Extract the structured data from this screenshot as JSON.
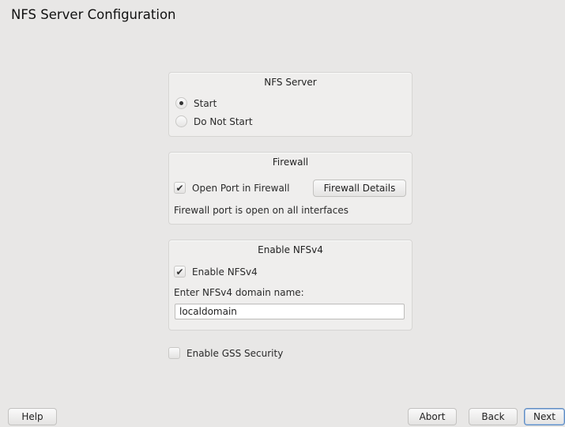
{
  "window": {
    "title": "NFS Server Configuration"
  },
  "nfs_server": {
    "title": "NFS Server",
    "options": [
      {
        "label": "Start",
        "selected": true
      },
      {
        "label": "Do Not Start",
        "selected": false
      }
    ]
  },
  "firewall": {
    "title": "Firewall",
    "open_port_label": "Open Port in Firewall",
    "open_port_checked": true,
    "details_button": "Firewall Details",
    "status_text": "Firewall port is open on all interfaces"
  },
  "nfsv4": {
    "title": "Enable NFSv4",
    "enable_label": "Enable NFSv4",
    "enable_checked": true,
    "domain_label": "Enter NFSv4 domain name:",
    "domain_value": "localdomain"
  },
  "gss": {
    "label": "Enable GSS Security",
    "checked": false
  },
  "footer": {
    "help": "Help",
    "abort": "Abort",
    "back": "Back",
    "next": "Next"
  }
}
